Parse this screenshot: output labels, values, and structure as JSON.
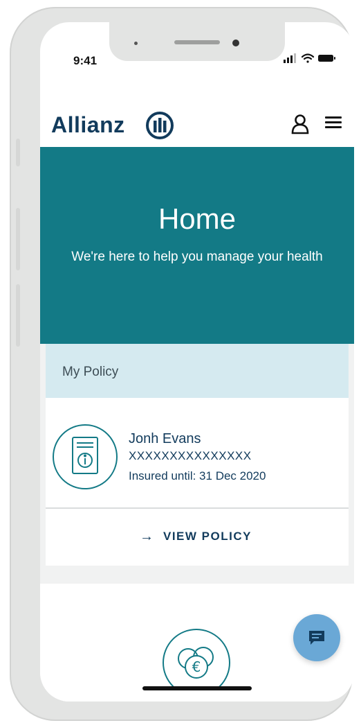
{
  "status_bar": {
    "time": "9:41",
    "icons": [
      "signal-icon",
      "wifi-icon",
      "battery-icon"
    ]
  },
  "header": {
    "logo_text": "Allianz",
    "icons": [
      "allianz-logo-mark-icon",
      "user-icon",
      "menu-icon"
    ]
  },
  "hero": {
    "title": "Home",
    "subtitle": "We're here to help you manage your health",
    "background_color": "#137a86"
  },
  "policy": {
    "section_label": "My Policy",
    "holder_name": "Jonh Evans",
    "policy_number": "XXXXXXXXXXXXXXX",
    "insured_until": "Insured until: 31 Dec 2020",
    "view_label": "VIEW POLICY",
    "section_background": "#d5eaf0",
    "icon": "policy-document-icon"
  },
  "lower_card": {
    "icon": "euro-coins-icon"
  },
  "chat": {
    "icon": "chat-icon",
    "color": "#6aa8d6"
  },
  "colors": {
    "brand_navy": "#123b5c",
    "brand_teal": "#137a86"
  }
}
